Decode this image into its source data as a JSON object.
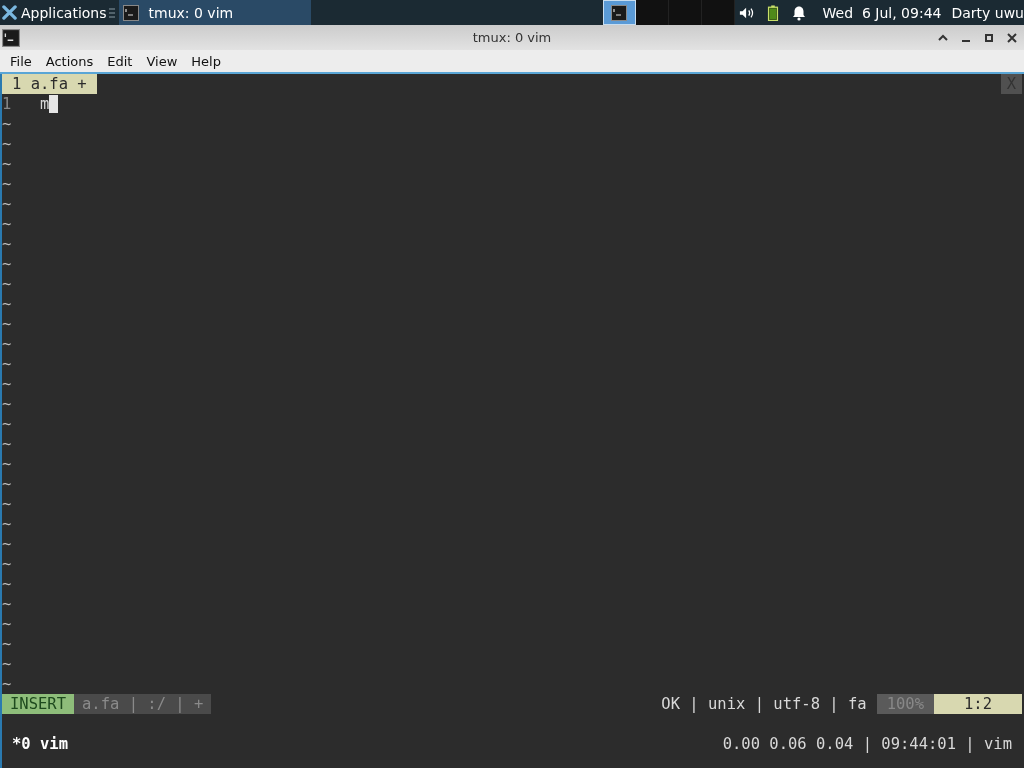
{
  "taskbar": {
    "apps_label": "Applications",
    "tasks": [
      {
        "title": "tmux: 0 vim",
        "selected": true
      }
    ],
    "workspaces": [
      {
        "selected": true
      },
      {
        "selected": false
      },
      {
        "selected": false
      },
      {
        "selected": false
      }
    ],
    "clock": "Wed  6 Jul, 09:44",
    "user": "Darty uwu"
  },
  "window": {
    "title": "tmux: 0 vim"
  },
  "menu": [
    "File",
    "Actions",
    "Edit",
    "View",
    "Help"
  ],
  "vim": {
    "tabs": [
      {
        "label": "1 a.fa +",
        "selected": true
      }
    ],
    "close_tab": "X",
    "lines": [
      {
        "number": "1",
        "text": "m"
      }
    ],
    "tildes": [
      "~",
      "~",
      "~",
      "~",
      "~",
      "~",
      "~",
      "~",
      "~",
      "~",
      "~",
      "~",
      "~",
      "~",
      "~",
      "~",
      "~",
      "~",
      "~",
      "~",
      "~",
      "~",
      "~",
      "~",
      "~",
      "~",
      "~",
      "~",
      "~"
    ],
    "statusline": {
      "mode": "INSERT",
      "left": "a.fa | :/ | +",
      "info": "OK | unix | utf-8 | fa",
      "percent": "100%",
      "position": "1:2"
    }
  },
  "tmux": {
    "window": "*0 vim",
    "right": "0.00 0.06 0.04 | 09:44:01 | vim"
  }
}
